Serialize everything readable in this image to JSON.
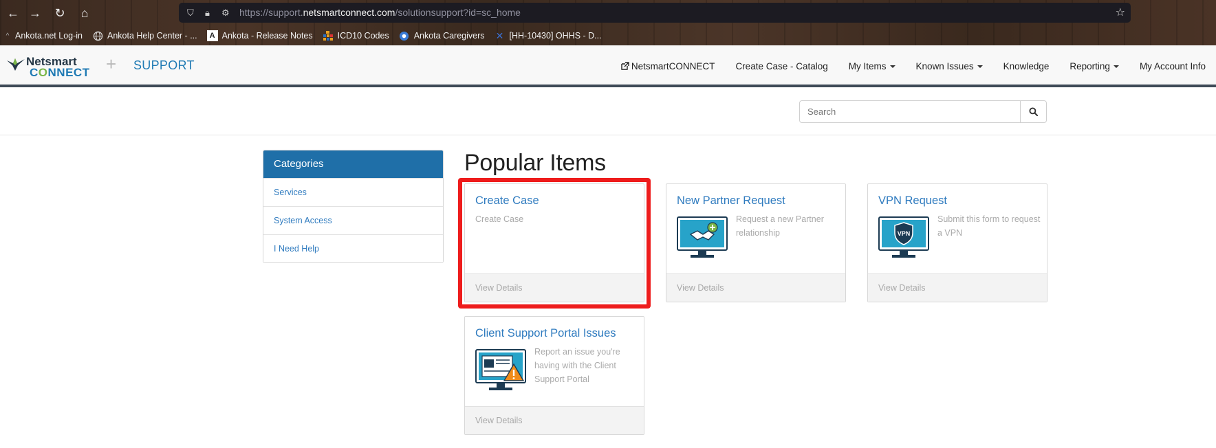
{
  "browser": {
    "url_prefix": "https://support.",
    "url_host": "netsmartconnect.com",
    "url_path": "/solutionsupport?id=sc_home",
    "bookmarks": [
      {
        "label": "Ankota.net Log-in"
      },
      {
        "label": "Ankota Help Center - ..."
      },
      {
        "label": "Ankota - Release Notes"
      },
      {
        "label": "ICD10 Codes"
      },
      {
        "label": "Ankota Caregivers"
      },
      {
        "label": "[HH-10430] OHHS - D..."
      }
    ]
  },
  "header": {
    "logo_line1": "Netsmart",
    "logo_line2a": "C",
    "logo_line2b": "NNECT",
    "plus": "+",
    "support": "SUPPORT",
    "nav": {
      "netsmartconnect": "NetsmartCONNECT",
      "create_case_catalog": "Create Case - Catalog",
      "my_items": "My Items",
      "known_issues": "Known Issues",
      "knowledge": "Knowledge",
      "reporting": "Reporting",
      "my_account_info": "My Account Info"
    }
  },
  "search": {
    "placeholder": "Search"
  },
  "categories": {
    "title": "Categories",
    "items": [
      {
        "label": "Services"
      },
      {
        "label": "System Access"
      },
      {
        "label": "I Need Help"
      }
    ]
  },
  "popular": {
    "title": "Popular Items",
    "cards": [
      {
        "title": "Create Case",
        "desc": "Create Case",
        "footer": "View Details"
      },
      {
        "title": "New Partner Request",
        "desc": "Request a new Partner relationship",
        "footer": "View Details"
      },
      {
        "title": "VPN Request",
        "desc": "Submit this form to request a VPN",
        "footer": "View Details",
        "icon_text": "VPN"
      },
      {
        "title": "Client Support Portal Issues",
        "desc": "Report an issue you're having with the Client Support Portal",
        "footer": "View Details"
      }
    ]
  },
  "colors": {
    "brand_blue": "#1f7ab4",
    "category_head": "#1f6fa8",
    "highlight": "#ee1c1c"
  }
}
